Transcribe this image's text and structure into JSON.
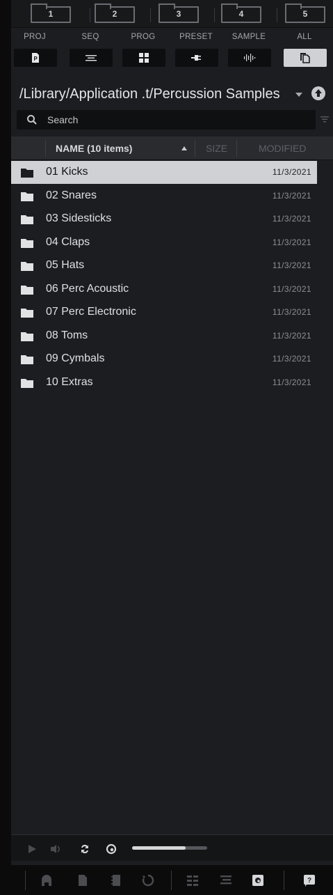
{
  "location_tabs": [
    "1",
    "2",
    "3",
    "4",
    "5"
  ],
  "filters": [
    {
      "label": "PROJ",
      "icon": "project-icon",
      "active": false
    },
    {
      "label": "SEQ",
      "icon": "sequence-icon",
      "active": false
    },
    {
      "label": "PROG",
      "icon": "program-icon",
      "active": false
    },
    {
      "label": "PRESET",
      "icon": "preset-plug-icon",
      "active": false
    },
    {
      "label": "SAMPLE",
      "icon": "waveform-icon",
      "active": false
    },
    {
      "label": "ALL",
      "icon": "all-files-icon",
      "active": true
    }
  ],
  "path": "/Library/Application .t/Percussion Samples",
  "search": {
    "placeholder": "Search"
  },
  "columns": {
    "name": "NAME (10 items)",
    "size": "SIZE",
    "modified": "MODIFIED"
  },
  "items": [
    {
      "name": "01 Kicks",
      "modified": "11/3/2021",
      "selected": true
    },
    {
      "name": "02 Snares",
      "modified": "11/3/2021",
      "selected": false
    },
    {
      "name": "03 Sidesticks",
      "modified": "11/3/2021",
      "selected": false
    },
    {
      "name": "04 Claps",
      "modified": "11/3/2021",
      "selected": false
    },
    {
      "name": "05 Hats",
      "modified": "11/3/2021",
      "selected": false
    },
    {
      "name": "06 Perc Acoustic",
      "modified": "11/3/2021",
      "selected": false
    },
    {
      "name": "07 Perc Electronic",
      "modified": "11/3/2021",
      "selected": false
    },
    {
      "name": "08 Toms",
      "modified": "11/3/2021",
      "selected": false
    },
    {
      "name": "09 Cymbals",
      "modified": "11/3/2021",
      "selected": false
    },
    {
      "name": "10 Extras",
      "modified": "11/3/2021",
      "selected": false
    }
  ],
  "preview": {
    "volume_fraction": 0.71
  },
  "colors": {
    "selected_row": "#cfd1d4",
    "panel": "#1c1d20",
    "accent_light": "#d6d7d9"
  }
}
